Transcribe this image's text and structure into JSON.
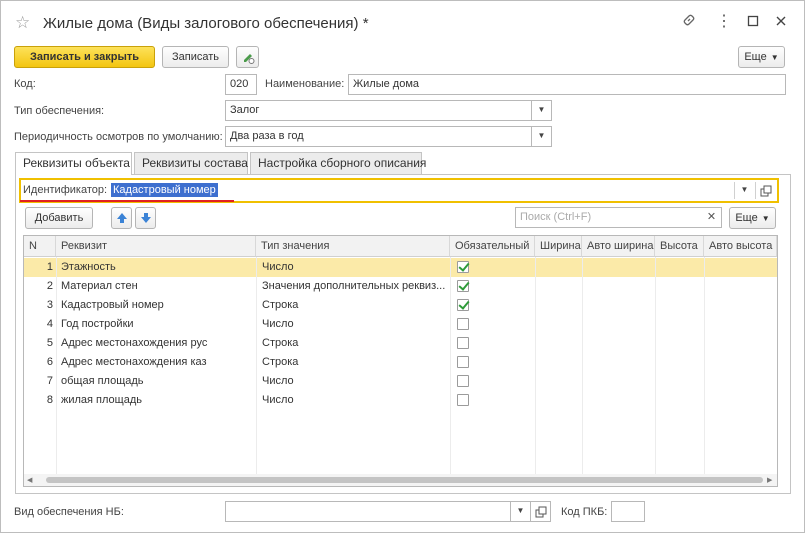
{
  "window": {
    "title": "Жилые дома (Виды залогового обеспечения) *"
  },
  "toolbar": {
    "save_close_label": "Записать и закрыть",
    "save_label": "Записать",
    "more_label": "Еще"
  },
  "form": {
    "code_label": "Код:",
    "code_value": "020",
    "name_label": "Наименование:",
    "name_value": "Жилые дома",
    "type_label": "Тип обеспечения:",
    "type_value": "Залог",
    "period_label": "Периодичность осмотров по умолчанию:",
    "period_value": "Два раза в год"
  },
  "tabs": [
    {
      "label": "Реквизиты объекта"
    },
    {
      "label": "Реквизиты состава"
    },
    {
      "label": "Настройка сборного описания"
    }
  ],
  "identifier": {
    "label": "Идентификатор:",
    "value": "Кадастровый номер"
  },
  "grid_toolbar": {
    "add_label": "Добавить",
    "search_placeholder": "Поиск (Ctrl+F)",
    "more_label": "Еще"
  },
  "table": {
    "columns": [
      "N",
      "Реквизит",
      "Тип значения",
      "Обязательный",
      "Ширина",
      "Авто ширина",
      "Высота",
      "Авто высота"
    ],
    "rows": [
      {
        "n": "1",
        "name": "Этажность",
        "type": "Число",
        "required": true
      },
      {
        "n": "2",
        "name": "Материал стен",
        "type": "Значения дополнительных реквиз...",
        "required": true
      },
      {
        "n": "3",
        "name": "Кадастровый номер",
        "type": "Строка",
        "required": true
      },
      {
        "n": "4",
        "name": "Год постройки",
        "type": "Число",
        "required": false
      },
      {
        "n": "5",
        "name": "Адрес местонахождения рус",
        "type": "Строка",
        "required": false
      },
      {
        "n": "6",
        "name": "Адрес местонахождения каз",
        "type": "Строка",
        "required": false
      },
      {
        "n": "7",
        "name": "общая площадь",
        "type": "Число",
        "required": false
      },
      {
        "n": "8",
        "name": "жилая площадь",
        "type": "Число",
        "required": false
      }
    ]
  },
  "footer": {
    "nb_label": "Вид обеспечения НБ:",
    "nb_value": "",
    "pkb_label": "Код ПКБ:",
    "pkb_value": ""
  },
  "colors": {
    "primary_button": "#f5c813",
    "selected_row": "#fbeaa8",
    "highlight_border": "#f0c000",
    "underline_red": "#e02020",
    "selection_blue": "#3d6fcf",
    "check_green": "#2e9b39"
  }
}
